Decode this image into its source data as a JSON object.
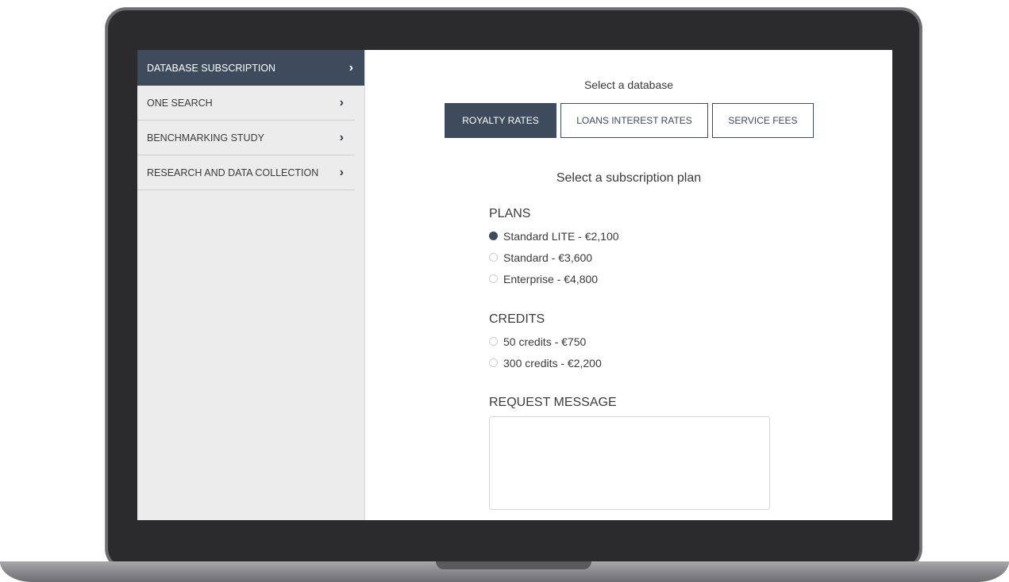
{
  "sidebar": {
    "items": [
      {
        "label": "DATABASE SUBSCRIPTION",
        "chevron": "›",
        "active": true
      },
      {
        "label": "ONE SEARCH",
        "chevron": "›"
      },
      {
        "label": "BENCHMARKING STUDY",
        "chevron": "›"
      },
      {
        "label": "RESEARCH AND DATA COLLECTION",
        "chevron": "›"
      }
    ]
  },
  "main": {
    "database_label": "Select a database",
    "tabs": [
      {
        "label": "ROYALTY RATES",
        "active": true
      },
      {
        "label": "LOANS INTEREST RATES"
      },
      {
        "label": "SERVICE FEES"
      }
    ],
    "plan_label": "Select a subscription plan",
    "plans": {
      "title": "PLANS",
      "options": [
        {
          "label": "Standard LITE - €2,100",
          "checked": true
        },
        {
          "label": "Standard - €3,600"
        },
        {
          "label": "Enterprise - €4,800"
        }
      ]
    },
    "credits": {
      "title": "CREDITS",
      "options": [
        {
          "label": "50 credits - €750"
        },
        {
          "label": "300 credits - €2,200"
        }
      ]
    },
    "message": {
      "title": "REQUEST MESSAGE",
      "value": ""
    }
  },
  "colors": {
    "accent": "#3d4b5c",
    "sidebar_bg": "#ececec",
    "bezel": "#2b2b2d"
  }
}
